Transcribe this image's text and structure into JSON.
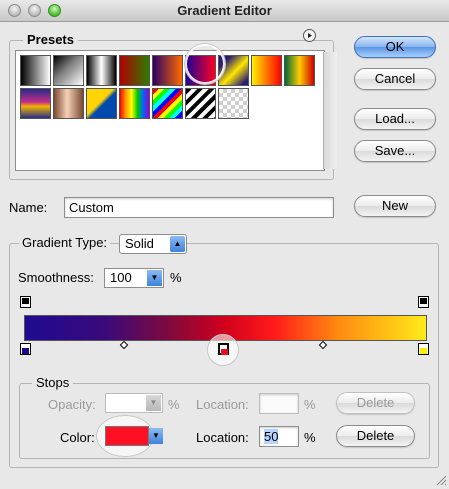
{
  "window": {
    "title": "Gradient Editor"
  },
  "presets": {
    "label": "Presets",
    "menu_icon": "circle-arrow-icon",
    "swatches_row1": [
      "linear-gradient(90deg,#000,#fff)",
      "linear-gradient(135deg,#000 0%,#777 40%,transparent 100%)",
      "linear-gradient(90deg,#000,#fff 50%,#000)",
      "linear-gradient(90deg,#b00000,#2f7d00)",
      "linear-gradient(90deg,#2b0066,#ff6a00)",
      "linear-gradient(90deg,#1b0096,#ff0022)",
      "linear-gradient(135deg,#2a1d72 20%,#ffe700 55%,#2a1d72 90%)",
      "linear-gradient(90deg,#ffee00,#ff7700,#ff0000)",
      "linear-gradient(90deg,#006837,#ffcc00,#cc0000)"
    ],
    "swatches_row2": [
      "linear-gradient(180deg,#262c88,#c62d8a 45%,#f3b400 60%,#262c88)",
      "linear-gradient(90deg,#7a4a30,#f7d0b9 45%,#7a4a30)",
      "linear-gradient(135deg,#ffd400 45%,#004aad 55%)",
      "linear-gradient(90deg,#ff0000,#ff9900,#ffff00,#00cc00,#0066ff,#9900cc)",
      "repeating-linear-gradient(135deg,#ff0000 0 4px,#ffff00 4px 8px,#00ff00 8px 12px,#00ffff 12px 16px,#0000ff 16px 20px)",
      "repeating-linear-gradient(135deg,#000 0 4px,#fff 4px 8px)",
      "repeating-conic-gradient(#cfcfcf 0 25%, #fff 0 50%) 0 0 / 8px 8px"
    ]
  },
  "buttons": {
    "ok": "OK",
    "cancel": "Cancel",
    "load": "Load...",
    "save": "Save...",
    "new": "New",
    "delete_opacity": "Delete",
    "delete_color": "Delete"
  },
  "name_field": {
    "label": "Name:",
    "value": "Custom"
  },
  "gradient_type": {
    "label": "Gradient Type:",
    "value": "Solid"
  },
  "smoothness": {
    "label": "Smoothness:",
    "value": "100",
    "unit": "%"
  },
  "gradient": {
    "css": "linear-gradient(90deg,#1e0a90 0%,#3a0a7a 20%,#7a0a40 35%,#d2001c 50%,#ff1a1a 62%,#ff8a10 78%,#ffea1a 100%)",
    "color_stops": [
      "#1a0a8a",
      "#e80e1e",
      "#ffee00"
    ],
    "opacity_stops": [
      "#000000",
      "#000000"
    ]
  },
  "stops": {
    "label": "Stops",
    "opacity": {
      "label": "Opacity:",
      "value": "",
      "unit": "%"
    },
    "opacity_location": {
      "label": "Location:",
      "value": "",
      "unit": "%"
    },
    "color": {
      "label": "Color:",
      "swatch": "#ff1024"
    },
    "color_location": {
      "label": "Location:",
      "value": "50",
      "unit": "%"
    }
  },
  "colors": {
    "window_bg": "#e8e8e8",
    "accent_blue": "#5a96e6"
  }
}
